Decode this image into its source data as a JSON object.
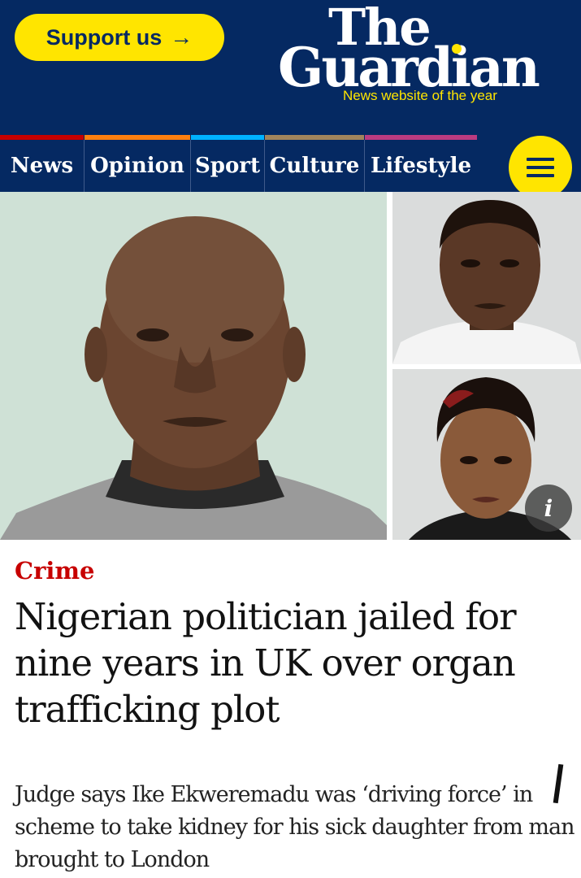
{
  "header": {
    "support_label": "Support us",
    "support_arrow": "→",
    "logo_line1": "The",
    "logo_line2": "Guardian",
    "tagline": "News website of the year"
  },
  "pillar_colors": [
    "#c70000",
    "#ff7f0f",
    "#00b2ff",
    "#a1845c",
    "#bb3b80"
  ],
  "nav": {
    "items": [
      {
        "label": "News"
      },
      {
        "label": "Opinion"
      },
      {
        "label": "Sport"
      },
      {
        "label": "Culture"
      },
      {
        "label": "Lifestyle"
      }
    ]
  },
  "media": {
    "info_glyph": "i"
  },
  "article": {
    "kicker": "Crime",
    "headline": "Nigerian politician jailed for nine years in UK over organ trafficking plot",
    "standfirst": "Judge says Ike Ekweremadu was ‘driving force’ in scheme to take kidney for his sick daughter from man brought to London"
  }
}
